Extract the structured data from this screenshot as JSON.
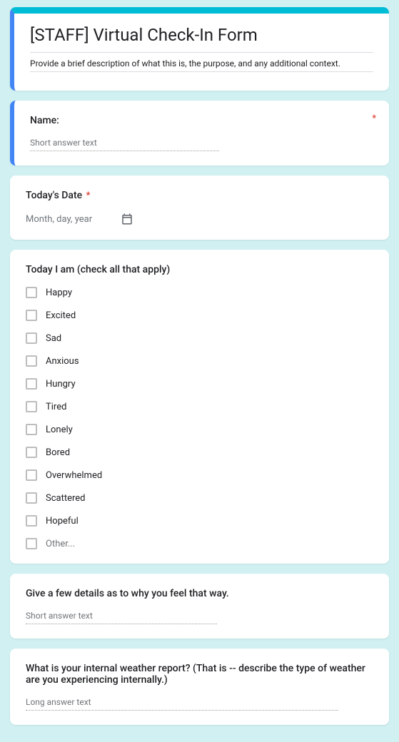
{
  "header": {
    "title": "[STAFF] Virtual Check-In Form",
    "description": "Provide a brief description of what this is, the purpose, and any additional context."
  },
  "questions": {
    "name": {
      "label": "Name:",
      "placeholder": "Short answer text",
      "required": true
    },
    "date": {
      "label": "Today's Date",
      "placeholder": "Month, day, year",
      "required": true
    },
    "today_i_am": {
      "label": "Today I am  (check all that apply)",
      "options": [
        "Happy",
        "Excited",
        "Sad",
        "Anxious",
        "Hungry",
        "Tired",
        "Lonely",
        "Bored",
        "Overwhelmed",
        "Scattered",
        "Hopeful"
      ],
      "other": "Other..."
    },
    "details": {
      "label": "Give a few details as to why you feel that way.",
      "placeholder": "Short answer text"
    },
    "weather": {
      "label": "What is your internal weather report? (That is --  describe the type of weather are you experiencing internally.)",
      "placeholder": "Long answer text"
    }
  }
}
